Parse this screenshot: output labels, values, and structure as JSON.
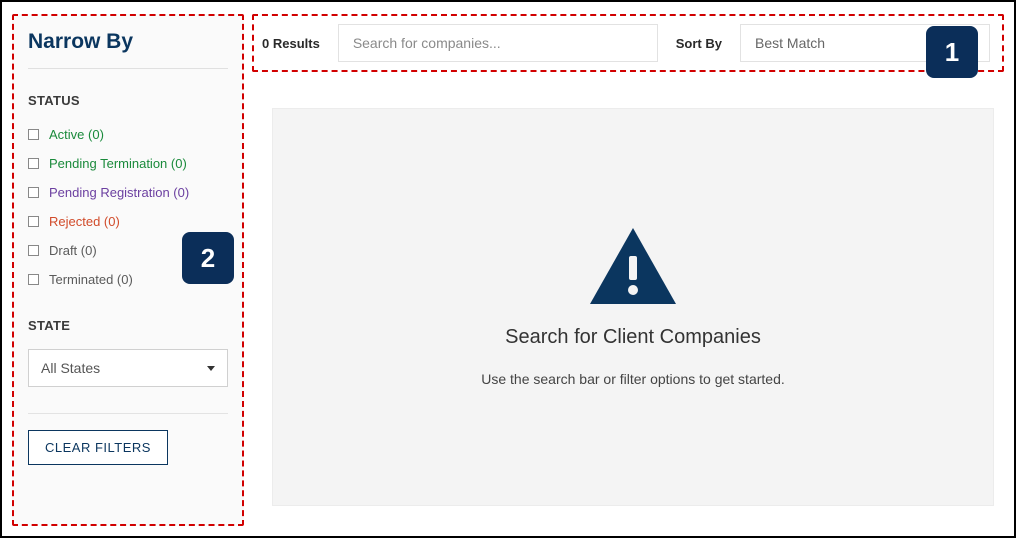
{
  "callouts": {
    "one": "1",
    "two": "2"
  },
  "sidebar": {
    "title": "Narrow By",
    "status_label": "STATUS",
    "status_items": [
      {
        "label": "Active (0)",
        "color": "#1a8a3b"
      },
      {
        "label": "Pending Termination (0)",
        "color": "#1a8a3b"
      },
      {
        "label": "Pending Registration (0)",
        "color": "#6b3fa0"
      },
      {
        "label": "Rejected (0)",
        "color": "#d14b2a"
      },
      {
        "label": "Draft (0)",
        "color": "#5a5a5a"
      },
      {
        "label": "Terminated (0)",
        "color": "#5a5a5a"
      }
    ],
    "state_label": "STATE",
    "state_value": "All States",
    "clear_label": "CLEAR FILTERS"
  },
  "topbar": {
    "results_text": "0 Results",
    "search_placeholder": "Search for companies...",
    "sortby_label": "Sort By",
    "sort_value": "Best Match"
  },
  "empty": {
    "title": "Search for Client Companies",
    "subtitle": "Use the search bar or filter options to get started."
  }
}
